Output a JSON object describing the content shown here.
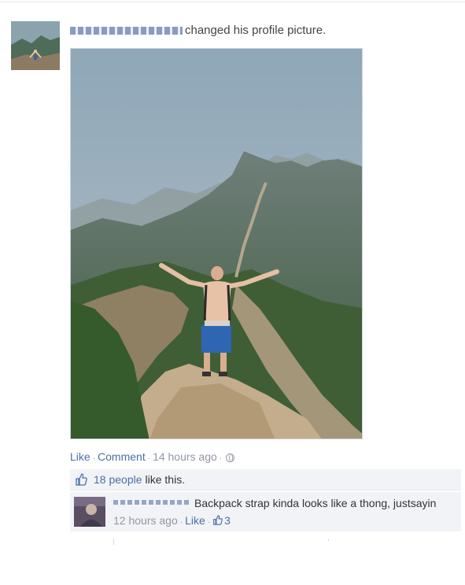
{
  "story": {
    "author_name_redacted": true,
    "action_text": "changed his profile picture."
  },
  "actions": {
    "like": "Like",
    "comment": "Comment",
    "time": "14 hours ago",
    "privacy_icon": "globe-icon"
  },
  "likes": {
    "icon": "thumbs-up-icon",
    "count_label": "18 people",
    "suffix": "like this."
  },
  "comment": {
    "author_redacted": true,
    "text": "Backpack strap kinda looks like a thong, justsayin",
    "time": "12 hours ago",
    "like_label": "Like",
    "like_icon": "thumbs-up-icon",
    "like_count": "3"
  },
  "colors": {
    "link": "#4a6ea9",
    "meta": "#9197a3",
    "ufi_bg": "#f2f3f6"
  }
}
